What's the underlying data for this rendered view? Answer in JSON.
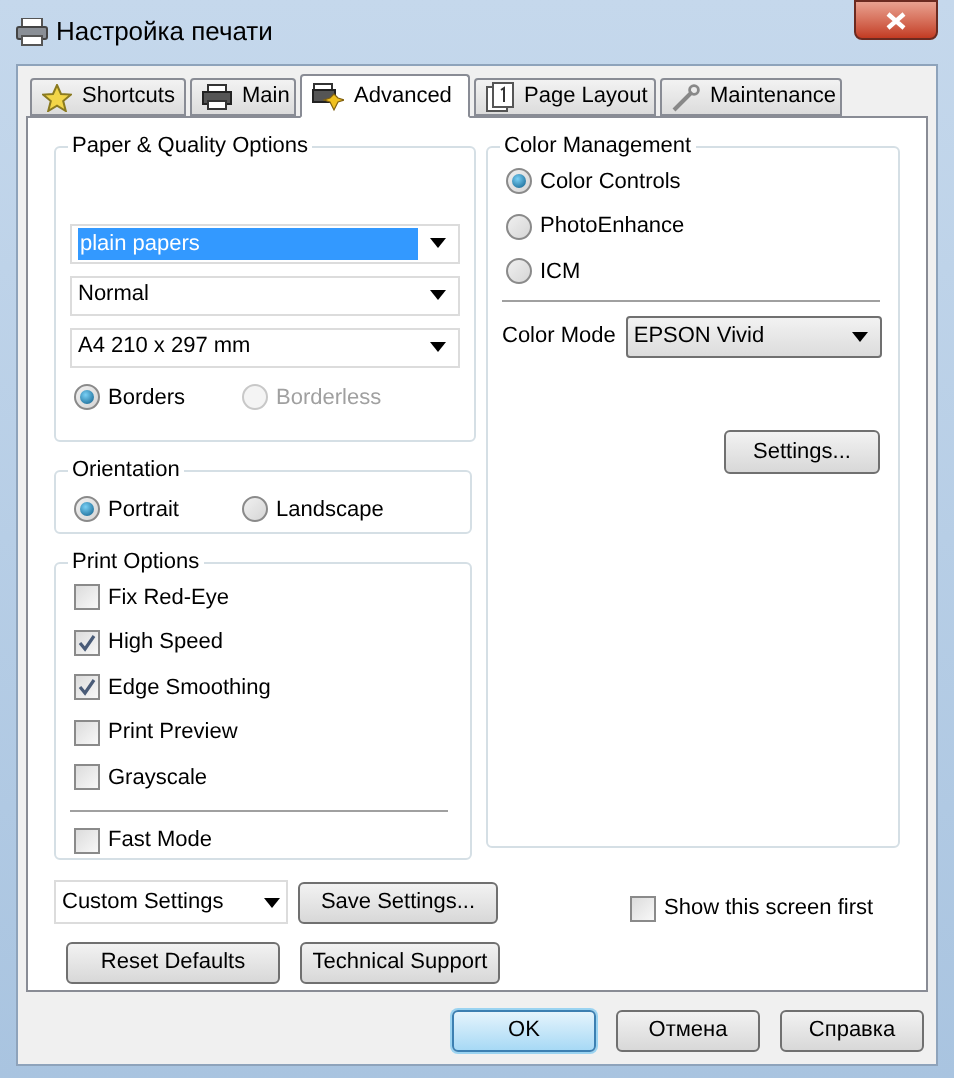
{
  "window": {
    "title": "Настройка печати"
  },
  "tabs": [
    {
      "label": "Shortcuts",
      "selected": false
    },
    {
      "label": "Main",
      "selected": false
    },
    {
      "label": "Advanced",
      "selected": true
    },
    {
      "label": "Page Layout",
      "selected": false
    },
    {
      "label": "Maintenance",
      "selected": false
    }
  ],
  "paper_quality": {
    "title": "Paper & Quality Options",
    "dropdowns": [
      {
        "value": "plain papers",
        "focused": true
      },
      {
        "value": "Normal",
        "focused": false
      },
      {
        "value": "A4 210 x 297 mm",
        "focused": false
      }
    ],
    "radios": [
      {
        "label": "Borders",
        "selected": true,
        "disabled": false
      },
      {
        "label": "Borderless",
        "selected": false,
        "disabled": true
      }
    ]
  },
  "orientation": {
    "title": "Orientation",
    "radios": [
      {
        "label": "Portrait",
        "selected": true,
        "disabled": false
      },
      {
        "label": "Landscape",
        "selected": false,
        "disabled": false
      }
    ]
  },
  "print_options": {
    "title": "Print Options",
    "checkboxes": [
      {
        "label": "Fix Red-Eye",
        "checked": false
      },
      {
        "label": "High Speed",
        "checked": true
      },
      {
        "label": "Edge Smoothing",
        "checked": true
      },
      {
        "label": "Print Preview",
        "checked": false
      },
      {
        "label": "Grayscale",
        "checked": false
      }
    ],
    "fast_mode": {
      "label": "Fast Mode",
      "checked": false
    }
  },
  "color_management": {
    "title": "Color Management",
    "radios": [
      {
        "label": "Color Controls",
        "selected": true,
        "disabled": false
      },
      {
        "label": "PhotoEnhance",
        "selected": false,
        "disabled": false
      },
      {
        "label": "ICM",
        "selected": false,
        "disabled": false
      }
    ],
    "color_mode": {
      "label": "Color Mode",
      "value": "EPSON Vivid"
    },
    "settings_button": "Settings..."
  },
  "custom_settings": {
    "value": "Custom Settings"
  },
  "save_settings_button": "Save Settings...",
  "reset_defaults_button": "Reset Defaults",
  "technical_support_button": "Technical Support",
  "show_first": {
    "label": "Show this screen first",
    "checked": false
  },
  "footer_buttons": [
    {
      "label": "OK",
      "default": true
    },
    {
      "label": "Отмена",
      "default": false
    },
    {
      "label": "Справка",
      "default": false
    }
  ]
}
